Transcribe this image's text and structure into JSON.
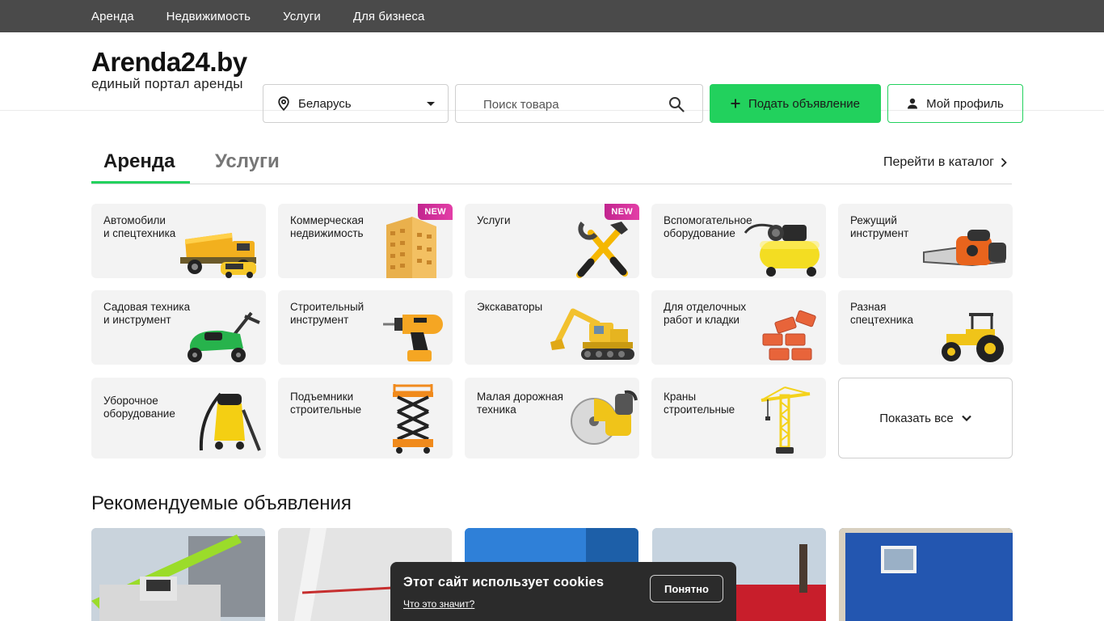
{
  "topnav": [
    "Аренда",
    "Недвижимость",
    "Услуги",
    "Для бизнеса"
  ],
  "logo": {
    "title": "Arenda24.by",
    "subtitle": "единый портал аренды"
  },
  "region": {
    "value": "Беларусь"
  },
  "search": {
    "placeholder": "Поиск товара"
  },
  "buttons": {
    "post_ad": "Подать объявление",
    "profile": "Мой профиль"
  },
  "tabs": {
    "rent": "Аренда",
    "services": "Услуги",
    "catalog": "Перейти в каталог"
  },
  "badge_new": "NEW",
  "categories": [
    {
      "label": "Автомобили\nи спецтехника",
      "icon": "dump-truck-icon"
    },
    {
      "label": "Коммерческая\nнедвижимость",
      "icon": "building-icon",
      "new": true
    },
    {
      "label": "Услуги",
      "icon": "tools-icon",
      "new": true
    },
    {
      "label": "Вспомогательное\nоборудование",
      "icon": "compressor-icon"
    },
    {
      "label": "Режущий\nинструмент",
      "icon": "chainsaw-icon"
    },
    {
      "label": "Садовая техника\nи инструмент",
      "icon": "lawnmower-icon"
    },
    {
      "label": "Строительный\nинструмент",
      "icon": "drill-icon"
    },
    {
      "label": "Экскаваторы",
      "icon": "excavator-icon"
    },
    {
      "label": "Для отделочных\nработ и кладки",
      "icon": "bricks-icon"
    },
    {
      "label": "Разная\nспецтехника",
      "icon": "tractor-icon"
    },
    {
      "label": "Уборочное\nоборудование",
      "icon": "vacuum-icon"
    },
    {
      "label": "Подъемники\nстроительные",
      "icon": "scissor-lift-icon"
    },
    {
      "label": "Малая дорожная\nтехника",
      "icon": "cutter-icon"
    },
    {
      "label": "Краны\nстроительные",
      "icon": "crane-icon"
    }
  ],
  "show_all": "Показать все",
  "recommended": {
    "title": "Рекомендуемые объявления"
  },
  "cookie": {
    "text": "Этот сайт использует cookies",
    "link": "Что это значит?",
    "button": "Понятно"
  }
}
